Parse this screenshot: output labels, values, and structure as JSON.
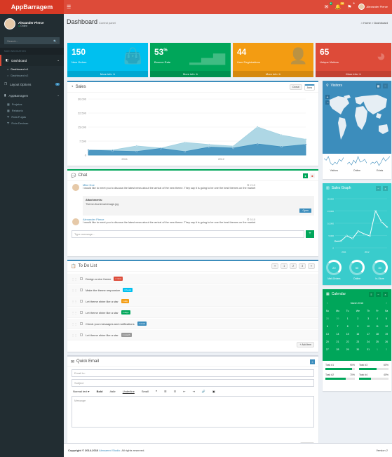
{
  "app": {
    "logo": "AppBarragem",
    "toggle_icon": "menu-icon"
  },
  "topbar": {
    "notifications": [
      {
        "icon": "envelope-icon",
        "count": "4",
        "color": "#00a65a"
      },
      {
        "icon": "bell-icon",
        "count": "10",
        "color": "#f39c12"
      },
      {
        "icon": "flag-icon",
        "count": "9",
        "color": "#dd4b39"
      }
    ],
    "user_name": "Alexander Pierce"
  },
  "sidebar": {
    "user_name": "Alexander Pierce",
    "status": "Online",
    "search_placeholder": "Search...",
    "header": "MAIN NAVIGATION",
    "items": [
      {
        "label": "Dashboard",
        "icon": "dashboard-icon"
      },
      {
        "label": "Dashboard v1"
      },
      {
        "label": "Dashboard v2"
      },
      {
        "label": "Layout Options",
        "badge": "4"
      },
      {
        "label": "AppBarragem"
      },
      {
        "label": "Projetos"
      },
      {
        "label": "Relatorio"
      },
      {
        "label": "Rota Fugas"
      },
      {
        "label": "Rota Decisao"
      }
    ]
  },
  "header": {
    "title": "Dashboard",
    "subtitle": "Control panel",
    "breadcrumb_home": "Home",
    "breadcrumb_current": "Dashboard"
  },
  "stats": [
    {
      "value": "150",
      "sup": "",
      "label": "New Orders",
      "footer": "More info",
      "color": "#00c0ef",
      "icon": "shopping-bag-icon"
    },
    {
      "value": "53",
      "sup": "%",
      "label": "Bounce Rate",
      "footer": "More info",
      "color": "#00a65a",
      "icon": "bar-chart-icon"
    },
    {
      "value": "44",
      "sup": "",
      "label": "User Registrations",
      "footer": "More info",
      "color": "#f39c12",
      "icon": "person-add-icon"
    },
    {
      "value": "65",
      "sup": "",
      "label": "Unique Visitors",
      "footer": "More info",
      "color": "#dd4b39",
      "icon": "pie-chart-icon"
    }
  ],
  "sales": {
    "title": "Sales",
    "tabs": [
      "Donut",
      "Area"
    ],
    "chart_data": {
      "type": "area",
      "x": [
        "2011 Q1",
        "2011 Q2",
        "2011 Q3",
        "2011 Q4",
        "2012 Q1",
        "2012 Q2",
        "2012 Q3",
        "2012 Q4",
        "2013 Q1",
        "2013 Q2"
      ],
      "x_ticks": [
        "2011",
        "2012"
      ],
      "series": [
        {
          "values": [
            2666,
            2778,
            4912,
            3767,
            6810,
            5670,
            4820,
            15073,
            10687,
            8432
          ],
          "color": "#a0d0e0"
        },
        {
          "values": [
            2666,
            2294,
            1969,
            3597,
            1914,
            4293,
            3795,
            5967,
            4460,
            5713
          ],
          "color": "#3c8dbc"
        }
      ],
      "yticks": [
        "0",
        "7,500",
        "15,000",
        "22,500",
        "30,000"
      ],
      "ylim": [
        0,
        30000
      ]
    }
  },
  "visitors": {
    "title": "Visitors",
    "sparklines": [
      {
        "label": "Visitors",
        "values": [
          10,
          8,
          12,
          5,
          3,
          6,
          4,
          9,
          7,
          11
        ]
      },
      {
        "label": "Online",
        "values": [
          4,
          6,
          3,
          8,
          5,
          12,
          6,
          7,
          9,
          5
        ]
      },
      {
        "label": "Exists",
        "values": [
          3,
          5,
          4,
          6,
          2,
          5,
          9,
          6,
          8,
          10
        ]
      }
    ]
  },
  "chat": {
    "title": "Chat",
    "messages": [
      {
        "name": "Mike Doe",
        "time": "2:15",
        "text": "I would like to meet you to discuss the latest news about the arrival of the new theme. They say it is going to be one the best themes on the market"
      },
      {
        "name": "Alexander Pierce",
        "time": "5:15",
        "text": "I would like to meet you to discuss the latest news about the arrival of the new theme. They say it is going to be one the best themes on the market"
      }
    ],
    "attachment_title": "Attachments:",
    "attachment_file": "Theme-thumbnail-image.jpg",
    "attachment_button": "Open",
    "input_placeholder": "Type message..."
  },
  "sales_graph": {
    "title": "Sales Graph",
    "chart_data": {
      "type": "line",
      "x": [
        "2011 Q1",
        "2011 Q2",
        "2011 Q3",
        "2011 Q4",
        "2012 Q1",
        "2012 Q2",
        "2012 Q3",
        "2012 Q4",
        "2013 Q1",
        "2013 Q2"
      ],
      "x_ticks": [
        "2011",
        "2012"
      ],
      "y": [
        2666,
        2778,
        4912,
        3767,
        6810,
        5670,
        4820,
        15073,
        10687,
        8432
      ],
      "yticks": [
        "0",
        "5,000",
        "10,000",
        "15,000",
        "20,000"
      ],
      "ylim": [
        0,
        20000
      ]
    },
    "knobs": [
      {
        "value": "20",
        "label": "Mail-Orders"
      },
      {
        "value": "50",
        "label": "Online"
      },
      {
        "value": "30",
        "label": "In-Store"
      }
    ]
  },
  "todo": {
    "title": "To Do List",
    "pagination": [
      "«",
      "1",
      "2",
      "3",
      "»"
    ],
    "items": [
      {
        "text": "Design a nice theme",
        "label": "2 mins",
        "color": "#dd4b39"
      },
      {
        "text": "Make the theme responsive",
        "label": "4 hours",
        "color": "#00c0ef"
      },
      {
        "text": "Let theme shine like a star",
        "label": "1 day",
        "color": "#f39c12"
      },
      {
        "text": "Let theme shine like a star",
        "label": "3 days",
        "color": "#00a65a"
      },
      {
        "text": "Check your messages and notifications",
        "label": "1 week",
        "color": "#3c8dbc"
      },
      {
        "text": "Let theme shine like a star",
        "label": "1 month",
        "color": "#999"
      }
    ],
    "add_button": "Add item"
  },
  "calendar": {
    "title": "Calendar",
    "month": "March 2016",
    "weekdays": [
      "Su",
      "Mo",
      "Tu",
      "We",
      "Th",
      "Fr",
      "Sa"
    ],
    "weeks": [
      [
        "28",
        "29",
        "1",
        "2",
        "3",
        "4",
        "5"
      ],
      [
        "6",
        "7",
        "8",
        "9",
        "10",
        "11",
        "12"
      ],
      [
        "13",
        "14",
        "15",
        "16",
        "17",
        "18",
        "19"
      ],
      [
        "20",
        "21",
        "22",
        "23",
        "24",
        "25",
        "26"
      ],
      [
        "27",
        "28",
        "29",
        "30",
        "31",
        "1",
        "2"
      ]
    ],
    "tasks": [
      {
        "label": "Task #1",
        "pct": "90%",
        "value": 90
      },
      {
        "label": "Task #2",
        "pct": "70%",
        "value": 70
      },
      {
        "label": "Task #3",
        "pct": "60%",
        "value": 60
      },
      {
        "label": "Task #4",
        "pct": "40%",
        "value": 40
      }
    ]
  },
  "email": {
    "title": "Quick Email",
    "to_placeholder": "Email to:",
    "subject_placeholder": "Subject",
    "toolbar": [
      "Normal text ▾",
      "Bold",
      "Italic",
      "Underline",
      "Small",
      "❝",
      "☰",
      "☷",
      "⇤",
      "⇥",
      "🔗",
      "▣"
    ],
    "message_placeholder": "Message",
    "send_button": "Send"
  },
  "footer": {
    "copyright": "Copyright © 2014-2016",
    "company": "Almsaeed Studio.",
    "rights": "All rights reserved.",
    "version": "Version 2"
  }
}
